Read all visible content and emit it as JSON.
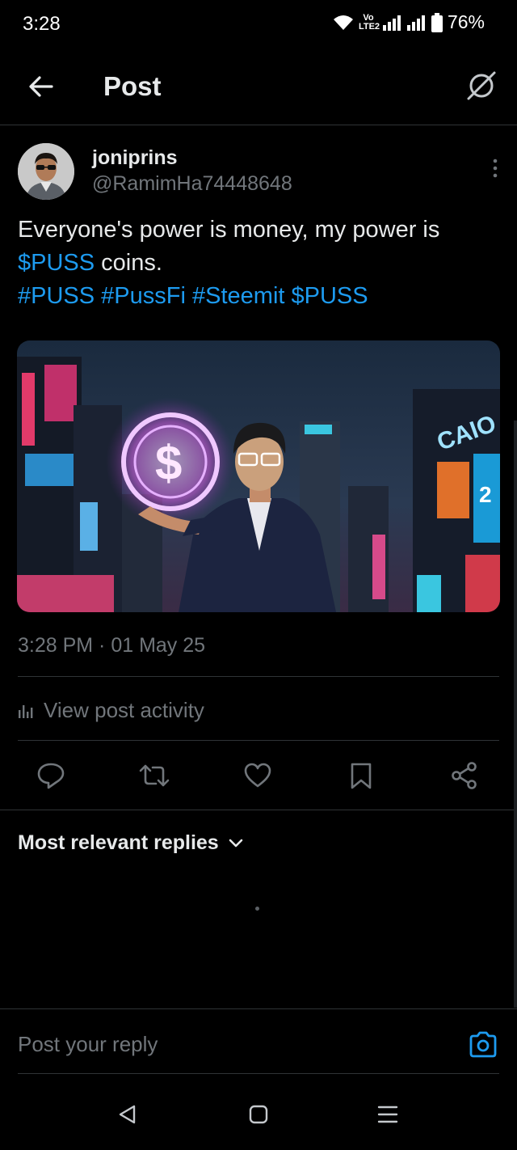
{
  "status_bar": {
    "time": "3:28",
    "network_tag": "Vo LTE2",
    "battery": "76%"
  },
  "header": {
    "title": "Post"
  },
  "post": {
    "author_name": "joniprins",
    "author_handle": "@RamimHa74448648",
    "text_part1": "Everyone's power is money, my power is ",
    "cashtag": "$PUSS",
    "text_part2": " coins.",
    "hashtags": [
      "#PUSS",
      "#PussFi",
      "#Steemit",
      "$PUSS"
    ],
    "timestamp": "3:28 PM · 01 May 25",
    "view_activity": "View post activity",
    "media_signs": [
      "CAIO",
      "2"
    ]
  },
  "actions": [
    "reply-icon",
    "retweet-icon",
    "like-icon",
    "bookmark-icon",
    "share-icon"
  ],
  "replies": {
    "filter_label": "Most relevant replies"
  },
  "composer": {
    "placeholder": "Post your reply"
  },
  "colors": {
    "background": "#000000",
    "text": "#e7e9ea",
    "muted": "#71767b",
    "accent": "#1d9bf0",
    "divider": "#2f3336"
  }
}
